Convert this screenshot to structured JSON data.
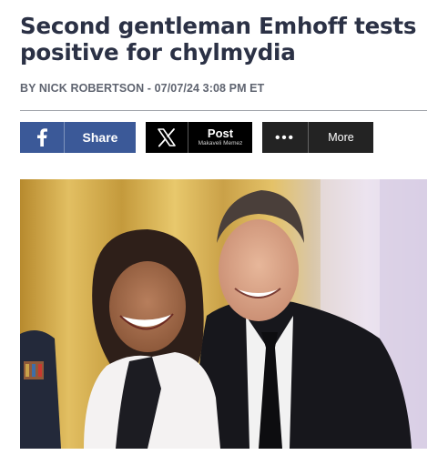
{
  "article": {
    "headline": "Second gentleman Emhoff tests positive for chylmydia",
    "byline": "BY NICK ROBERTSON - 07/07/24 3:08 PM ET"
  },
  "share": {
    "facebook": {
      "label": "Share",
      "icon": "facebook-icon",
      "color": "#3b5998"
    },
    "x": {
      "label": "Post",
      "icon": "x-logo-icon",
      "watermark": "Makaveli Memez",
      "color": "#000000"
    },
    "more": {
      "label": "More",
      "icon": "ellipsis-icon",
      "icon_text": "•••",
      "color": "#232323"
    }
  },
  "colors": {
    "headline": "#2b3145",
    "byline": "#5f6470",
    "rule": "#9ea1a8"
  }
}
